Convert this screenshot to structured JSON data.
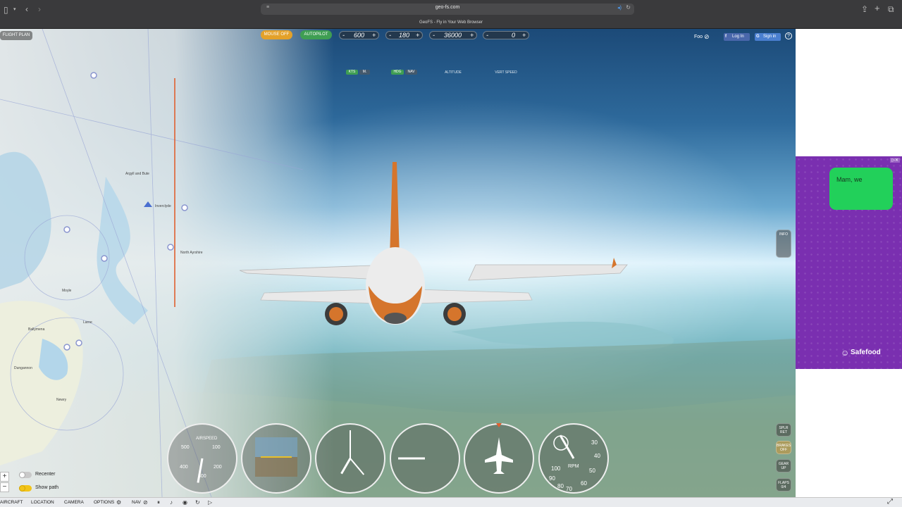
{
  "browser": {
    "url": "geo-fs.com",
    "tab_title": "GeoFS - Fly in Your Web Browser"
  },
  "map": {
    "flight_plan_label": "FLIGHT PLAN",
    "labels": [
      "Argyll and Bute",
      "Inverclyde",
      "North Ayrshire",
      "Moyle",
      "Larne",
      "Ballymena",
      "Dungannon",
      "Newry"
    ],
    "zoom_in": "+",
    "zoom_out": "−",
    "recenter_label": "Recenter",
    "show_path_label": "Show path"
  },
  "top_controls": {
    "mouse_label": "MOUSE OFF",
    "autopilot_label": "AUTOPILOT",
    "minus": "-",
    "plus": "+",
    "speed_value": "600",
    "speed_unit_kts": "KTS",
    "speed_unit_mach": "M.",
    "heading_value": "180",
    "heading_mode_hdg": "HDG",
    "heading_mode_nav": "NAV",
    "altitude_value": "36000",
    "altitude_label": "ALTITUDE",
    "vs_value": "0",
    "vs_label": "VERT SPEED"
  },
  "top_right": {
    "user_label": "Foo",
    "fb_login": "Log In",
    "g_signin": "Sign in",
    "help": "?"
  },
  "side_controls": {
    "info_label": "INFO",
    "spoilers_label": "SPLR RET",
    "brakes_label": "BRAKES OFF",
    "gear_label": "GEAR UP",
    "flaps_label": "FLAPS 0/4"
  },
  "instruments": {
    "airspeed_label": "AIRSPEED",
    "airspeed_ticks": [
      "500",
      "100",
      "400",
      "200",
      "300"
    ],
    "rpm_label": "RPM",
    "rpm_ticks": [
      "100",
      "30",
      "40",
      "90",
      "80",
      "50",
      "70",
      "60"
    ]
  },
  "ad": {
    "message": "Mam, we",
    "brand": "Safefood",
    "corner": "▷✕"
  },
  "bottom_menu": {
    "aircraft": "AIRCRAFT",
    "location": "LOCATION",
    "camera": "CAMERA",
    "options": "OPTIONS",
    "nav": "NAV"
  },
  "colors": {
    "mouse_btn": "#e3a12a",
    "autopilot_btn": "#3f9e53",
    "ad_bg": "#7a2fb0",
    "ad_bubble": "#22d05a"
  }
}
